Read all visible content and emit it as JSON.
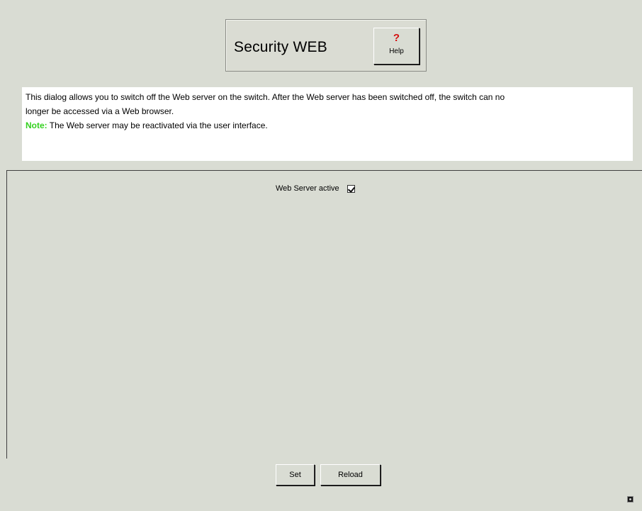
{
  "header": {
    "title": "Security WEB",
    "help_label": "Help",
    "help_icon_glyph": "?"
  },
  "description": {
    "line1": "This dialog allows you to switch off the Web server on the switch. After the Web server has been switched off, the switch can no",
    "line2": "longer be accessed via a Web browser.",
    "note_label": "Note:",
    "note_text": " The Web server may be reactivated via the user interface."
  },
  "settings": {
    "web_server_label": "Web Server active",
    "web_server_active": true
  },
  "buttons": {
    "set_label": "Set",
    "reload_label": "Reload"
  },
  "colors": {
    "background": "#d9dcd3",
    "note_green": "#33d11e",
    "help_red": "#d50f0f"
  },
  "icons": {
    "help": "help-question-icon",
    "corner": "applet-status-icon"
  }
}
